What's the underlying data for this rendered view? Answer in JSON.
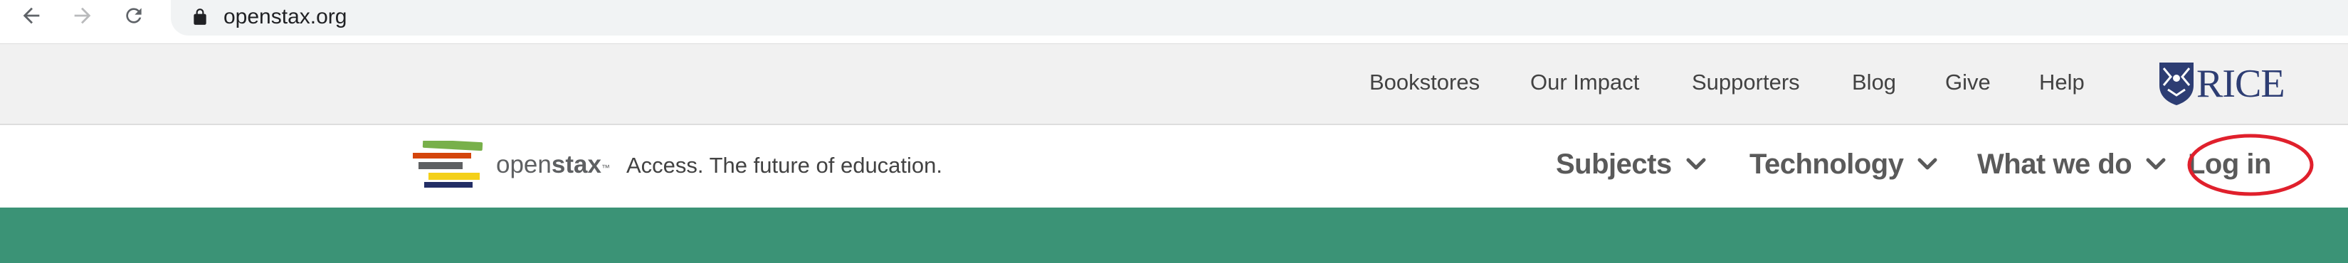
{
  "browser": {
    "url": "openstax.org",
    "icons": [
      "back-arrow-icon",
      "forward-arrow-icon",
      "reload-icon",
      "lock-icon"
    ]
  },
  "utility_nav": {
    "links": [
      "Bookstores",
      "Our Impact",
      "Supporters",
      "Blog",
      "Give",
      "Help"
    ],
    "partner_logo_text": "RICE"
  },
  "main_nav": {
    "brand_open": "open",
    "brand_stax": "stax",
    "brand_tm": "™",
    "tagline": "Access. The future of education.",
    "menu": [
      "Subjects",
      "Technology",
      "What we do"
    ],
    "login_label": "Log in"
  },
  "colors": {
    "accent_green": "#3b9376",
    "rice_blue": "#2d3d73",
    "highlight_red": "#e0202c",
    "utility_bg": "#f1f1f1"
  }
}
